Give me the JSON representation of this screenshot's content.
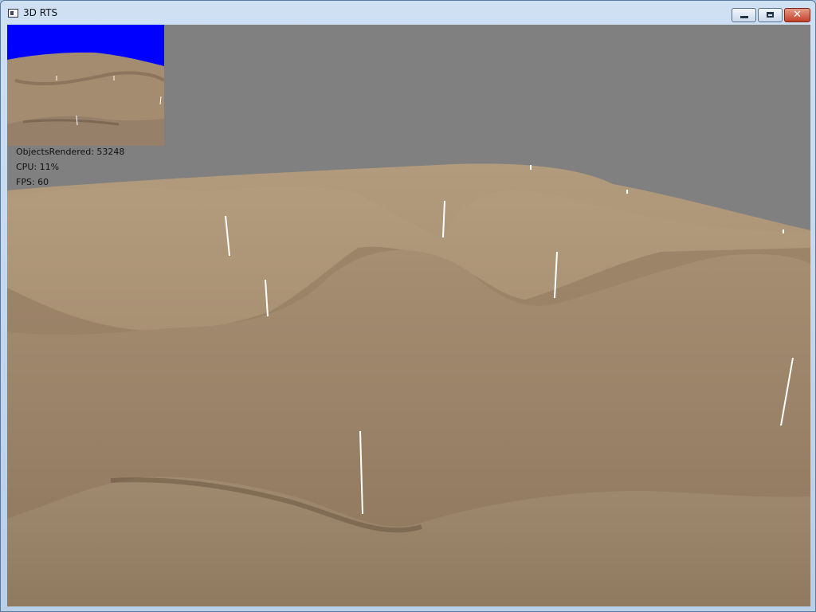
{
  "window": {
    "title": "3D RTS",
    "icon": "app-window-icon",
    "controls": [
      "minimize-icon",
      "maximize-icon",
      "close-icon"
    ],
    "close_glyph": "✕"
  },
  "hud": {
    "objects_rendered": "ObjectsRendered: 53248",
    "cpu": "CPU: 11%",
    "fps": "FPS: 60"
  },
  "colors": {
    "sky": "#808080",
    "minimap_sky": "#0000ff",
    "terrain": "#a48a6e",
    "unit_marker": "#ffffff"
  }
}
